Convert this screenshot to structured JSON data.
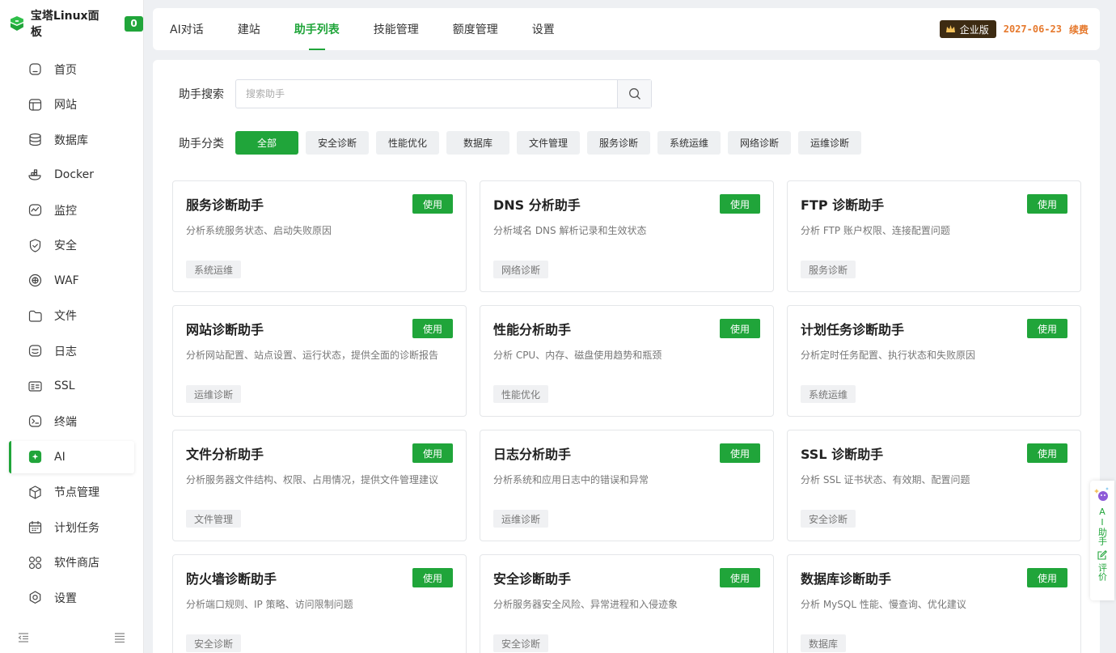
{
  "brand": {
    "name": "宝塔Linux面板",
    "badge": "0"
  },
  "sidebar": {
    "items": [
      {
        "label": "首页",
        "icon": "home-icon"
      },
      {
        "label": "网站",
        "icon": "website-icon"
      },
      {
        "label": "数据库",
        "icon": "database-icon"
      },
      {
        "label": "Docker",
        "icon": "docker-icon"
      },
      {
        "label": "监控",
        "icon": "monitor-icon"
      },
      {
        "label": "安全",
        "icon": "shield-icon"
      },
      {
        "label": "WAF",
        "icon": "waf-icon"
      },
      {
        "label": "文件",
        "icon": "folder-icon"
      },
      {
        "label": "日志",
        "icon": "log-icon"
      },
      {
        "label": "SSL",
        "icon": "ssl-icon"
      },
      {
        "label": "终端",
        "icon": "terminal-icon"
      },
      {
        "label": "AI",
        "icon": "ai-icon",
        "active": true
      },
      {
        "label": "节点管理",
        "icon": "node-icon"
      },
      {
        "label": "计划任务",
        "icon": "calendar-icon"
      },
      {
        "label": "软件商店",
        "icon": "store-icon"
      },
      {
        "label": "设置",
        "icon": "settings-icon"
      }
    ]
  },
  "topbar": {
    "tabs": [
      "AI对话",
      "建站",
      "助手列表",
      "技能管理",
      "额度管理",
      "设置"
    ],
    "active_tab": "助手列表",
    "edition": "企业版",
    "expire_date": "2027-06-23",
    "renew": "续费"
  },
  "search": {
    "label": "助手搜索",
    "placeholder": "搜索助手"
  },
  "categories": {
    "label": "助手分类",
    "items": [
      "全部",
      "安全诊断",
      "性能优化",
      "数据库",
      "文件管理",
      "服务诊断",
      "系统运维",
      "网络诊断",
      "运维诊断"
    ],
    "active": "全部"
  },
  "cards": [
    {
      "title": "服务诊断助手",
      "desc": "分析系统服务状态、启动失败原因",
      "tag": "系统运维",
      "button": "使用"
    },
    {
      "title": "DNS 分析助手",
      "desc": "分析域名 DNS 解析记录和生效状态",
      "tag": "网络诊断",
      "button": "使用"
    },
    {
      "title": "FTP 诊断助手",
      "desc": "分析 FTP 账户权限、连接配置问题",
      "tag": "服务诊断",
      "button": "使用"
    },
    {
      "title": "网站诊断助手",
      "desc": "分析网站配置、站点设置、运行状态，提供全面的诊断报告",
      "tag": "运维诊断",
      "button": "使用"
    },
    {
      "title": "性能分析助手",
      "desc": "分析 CPU、内存、磁盘使用趋势和瓶颈",
      "tag": "性能优化",
      "button": "使用"
    },
    {
      "title": "计划任务诊断助手",
      "desc": "分析定时任务配置、执行状态和失败原因",
      "tag": "系统运维",
      "button": "使用"
    },
    {
      "title": "文件分析助手",
      "desc": "分析服务器文件结构、权限、占用情况，提供文件管理建议",
      "tag": "文件管理",
      "button": "使用"
    },
    {
      "title": "日志分析助手",
      "desc": "分析系统和应用日志中的错误和异常",
      "tag": "运维诊断",
      "button": "使用"
    },
    {
      "title": "SSL 诊断助手",
      "desc": "分析 SSL 证书状态、有效期、配置问题",
      "tag": "安全诊断",
      "button": "使用"
    },
    {
      "title": "防火墙诊断助手",
      "desc": "分析端口规则、IP 策略、访问限制问题",
      "tag": "安全诊断",
      "button": "使用"
    },
    {
      "title": "安全诊断助手",
      "desc": "分析服务器安全风险、异常进程和入侵迹象",
      "tag": "安全诊断",
      "button": "使用"
    },
    {
      "title": "数据库诊断助手",
      "desc": "分析 MySQL 性能、慢查询、优化建议",
      "tag": "数据库",
      "button": "使用"
    }
  ],
  "float_panel": {
    "ai_label": "AI助手",
    "review_label": "评价"
  },
  "colors": {
    "accent": "#20a53a",
    "expire": "#e6792d",
    "edition_bg": "#3d2b12"
  }
}
